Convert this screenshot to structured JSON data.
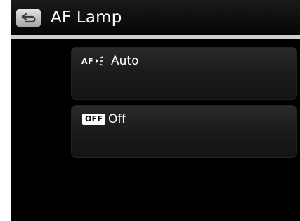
{
  "header": {
    "title": "AF Lamp",
    "back_icon": "back-arrow-icon"
  },
  "options": [
    {
      "icon_text": "AF",
      "icon": "af-lamp-icon",
      "label": "Auto"
    },
    {
      "icon_text": "OFF",
      "icon": "off-badge-icon",
      "label": "Off"
    }
  ],
  "colors": {
    "background": "#000000",
    "header_divider": "#cfcfcf",
    "text": "#ffffff"
  }
}
